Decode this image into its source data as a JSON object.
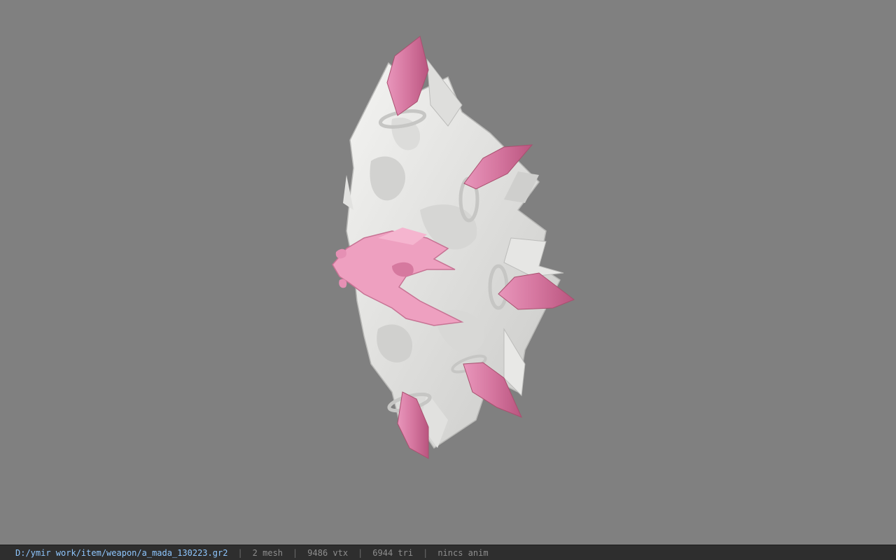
{
  "viewer": {
    "background_color": "#808080",
    "model_colors": {
      "body": "#e7e7e5",
      "crystal": "#d97aa6",
      "head": "#f0a6c4"
    }
  },
  "statusbar": {
    "file_path": "D:/ymir work/item/weapon/a_mada_130223.gr2",
    "separator": "|",
    "mesh": "2 mesh",
    "vertices": "9486 vtx",
    "triangles": "6944 tri",
    "anim": "nincs anim"
  }
}
